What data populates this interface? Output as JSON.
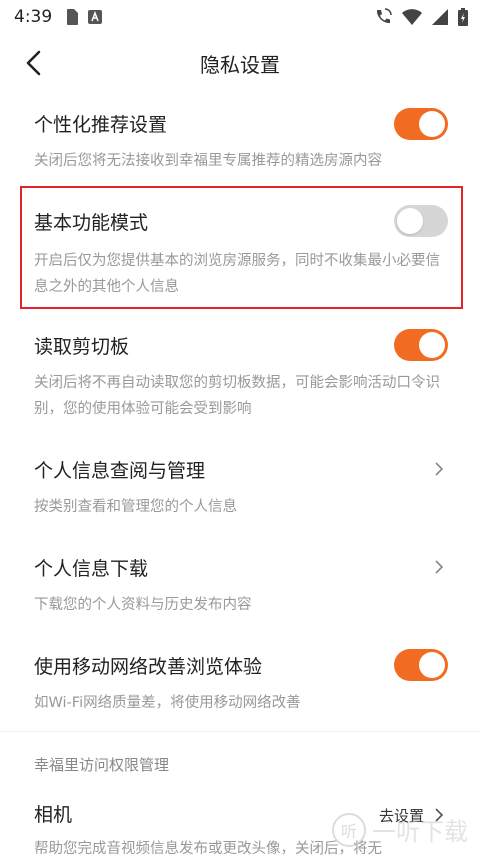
{
  "status_bar": {
    "time": "4:39",
    "left_icons": [
      "sim-card-icon",
      "font-a-icon"
    ],
    "right_icons": [
      "wifi-call-icon",
      "wifi-icon",
      "signal-icon",
      "battery-icon"
    ]
  },
  "header": {
    "title": "隐私设置",
    "back_icon": "chevron-left-icon"
  },
  "settings": [
    {
      "title": "个性化推荐设置",
      "description": "关闭后您将无法接收到幸福里专属推荐的精选房源内容",
      "control": "toggle",
      "checked": true
    },
    {
      "title": "基本功能模式",
      "description": "开启后仅为您提供基本的浏览房源服务，同时不收集最小必要信息之外的其他个人信息",
      "control": "toggle",
      "checked": false,
      "highlighted": true
    },
    {
      "title": "读取剪切板",
      "description": "关闭后将不再自动读取您的剪切板数据，可能会影响活动口令识别，您的使用体验可能会受到影响",
      "control": "toggle",
      "checked": true
    },
    {
      "title": "个人信息查阅与管理",
      "description": "按类别查看和管理您的个人信息",
      "control": "chevron"
    },
    {
      "title": "个人信息下载",
      "description": "下载您的个人资料与历史发布内容",
      "control": "chevron"
    },
    {
      "title": "使用移动网络改善浏览体验",
      "description": "如Wi-Fi网络质量差，将使用移动网络改善",
      "control": "toggle",
      "checked": true
    }
  ],
  "permissions_section": {
    "title": "幸福里访问权限管理",
    "items": [
      {
        "title": "相机",
        "action_label": "去设置",
        "description": "帮助您完成音视频信息发布或更改头像，关闭后，将无"
      }
    ]
  },
  "watermark": {
    "icon_text": "听",
    "text": "一听下载"
  },
  "colors": {
    "accent": "#f26b22",
    "toggle_off": "#d6d6d6",
    "highlight_border": "#e3242b",
    "description_text": "#999999"
  }
}
